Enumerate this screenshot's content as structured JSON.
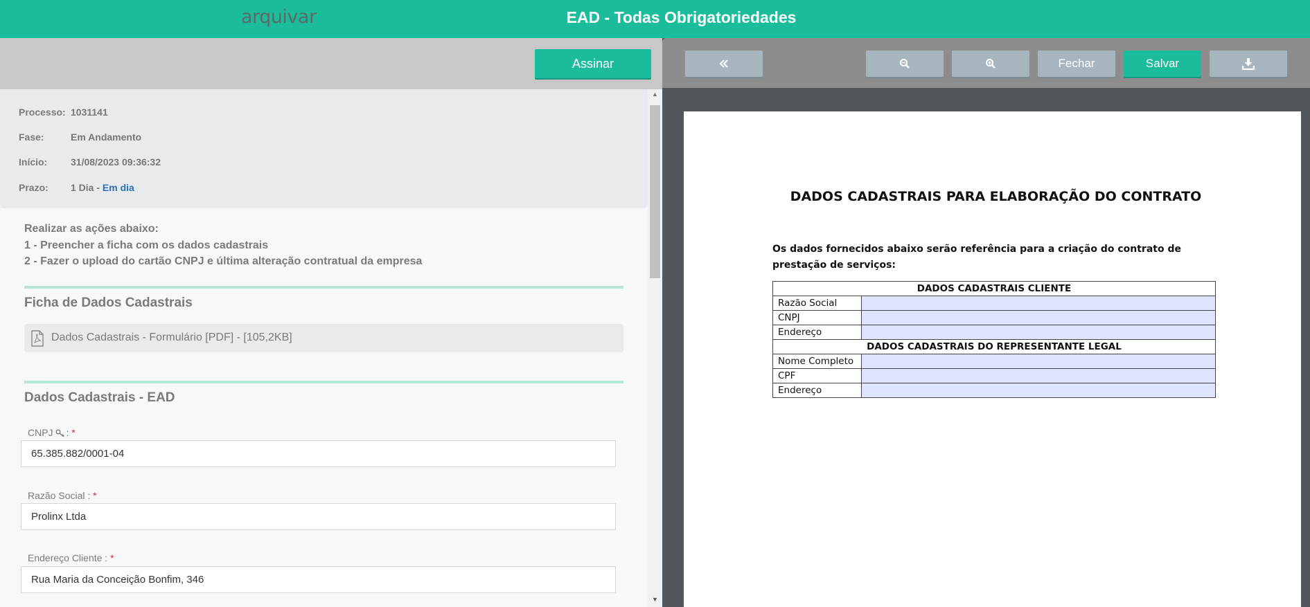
{
  "header": {
    "logo": "arquivar",
    "title": "EAD - Todas Obrigatoriedades"
  },
  "left_toolbar": {
    "sign_label": "Assinar"
  },
  "process_info": {
    "processo_label": "Processo:",
    "processo_value": "1031141",
    "fase_label": "Fase:",
    "fase_value": "Em Andamento",
    "inicio_label": "Início:",
    "inicio_value": "31/08/2023 09:36:32",
    "prazo_label": "Prazo:",
    "prazo_value": "1 Dia -",
    "prazo_status": "Em dia"
  },
  "instructions": {
    "line1": "Realizar as ações abaixo:",
    "line2": "1 - Preencher a ficha com os dados cadastrais",
    "line3": "2 - Fazer o upload do cartão CNPJ e última alteração contratual da empresa"
  },
  "ficha_section": {
    "title": "Ficha de Dados Cadastrais",
    "file_name": "Dados Cadastrais - Formulário [PDF] - [105,2KB]"
  },
  "form_section": {
    "title": "Dados Cadastrais - EAD",
    "fields": [
      {
        "label": "CNPJ",
        "label_suffix": ":",
        "required": "*",
        "value": "65.385.882/0001-04"
      },
      {
        "label": "Razão Social :",
        "required": "*",
        "value": "Prolinx Ltda"
      },
      {
        "label": "Endereço Cliente :",
        "required": "*",
        "value": "Rua Maria da Conceição Bonfim, 346"
      }
    ]
  },
  "viewer_toolbar": {
    "back_icon": "double-chevron-left-icon",
    "zoom_out_icon": "zoom-out-icon",
    "zoom_in_icon": "zoom-in-icon",
    "close_label": "Fechar",
    "save_label": "Salvar",
    "download_icon": "download-icon"
  },
  "document": {
    "title": "DADOS CADASTRAIS PARA ELABORAÇÃO DO CONTRATO",
    "intro": "Os dados fornecidos abaixo serão referência para a criação do contrato de prestação de serviços:",
    "client_header": "DADOS CADASTRAIS CLIENTE",
    "client_rows": [
      "Razão Social",
      "CNPJ",
      "Endereço"
    ],
    "rep_header": "DADOS CADASTRAIS DO REPRESENTANTE LEGAL",
    "rep_rows": [
      "Nome Completo",
      "CPF",
      "Endereço"
    ]
  },
  "colors": {
    "brand": "#1bbc9b",
    "status_ok": "#2a6fb5",
    "required": "#d42a2a",
    "form_fill": "#dfe5ff"
  }
}
